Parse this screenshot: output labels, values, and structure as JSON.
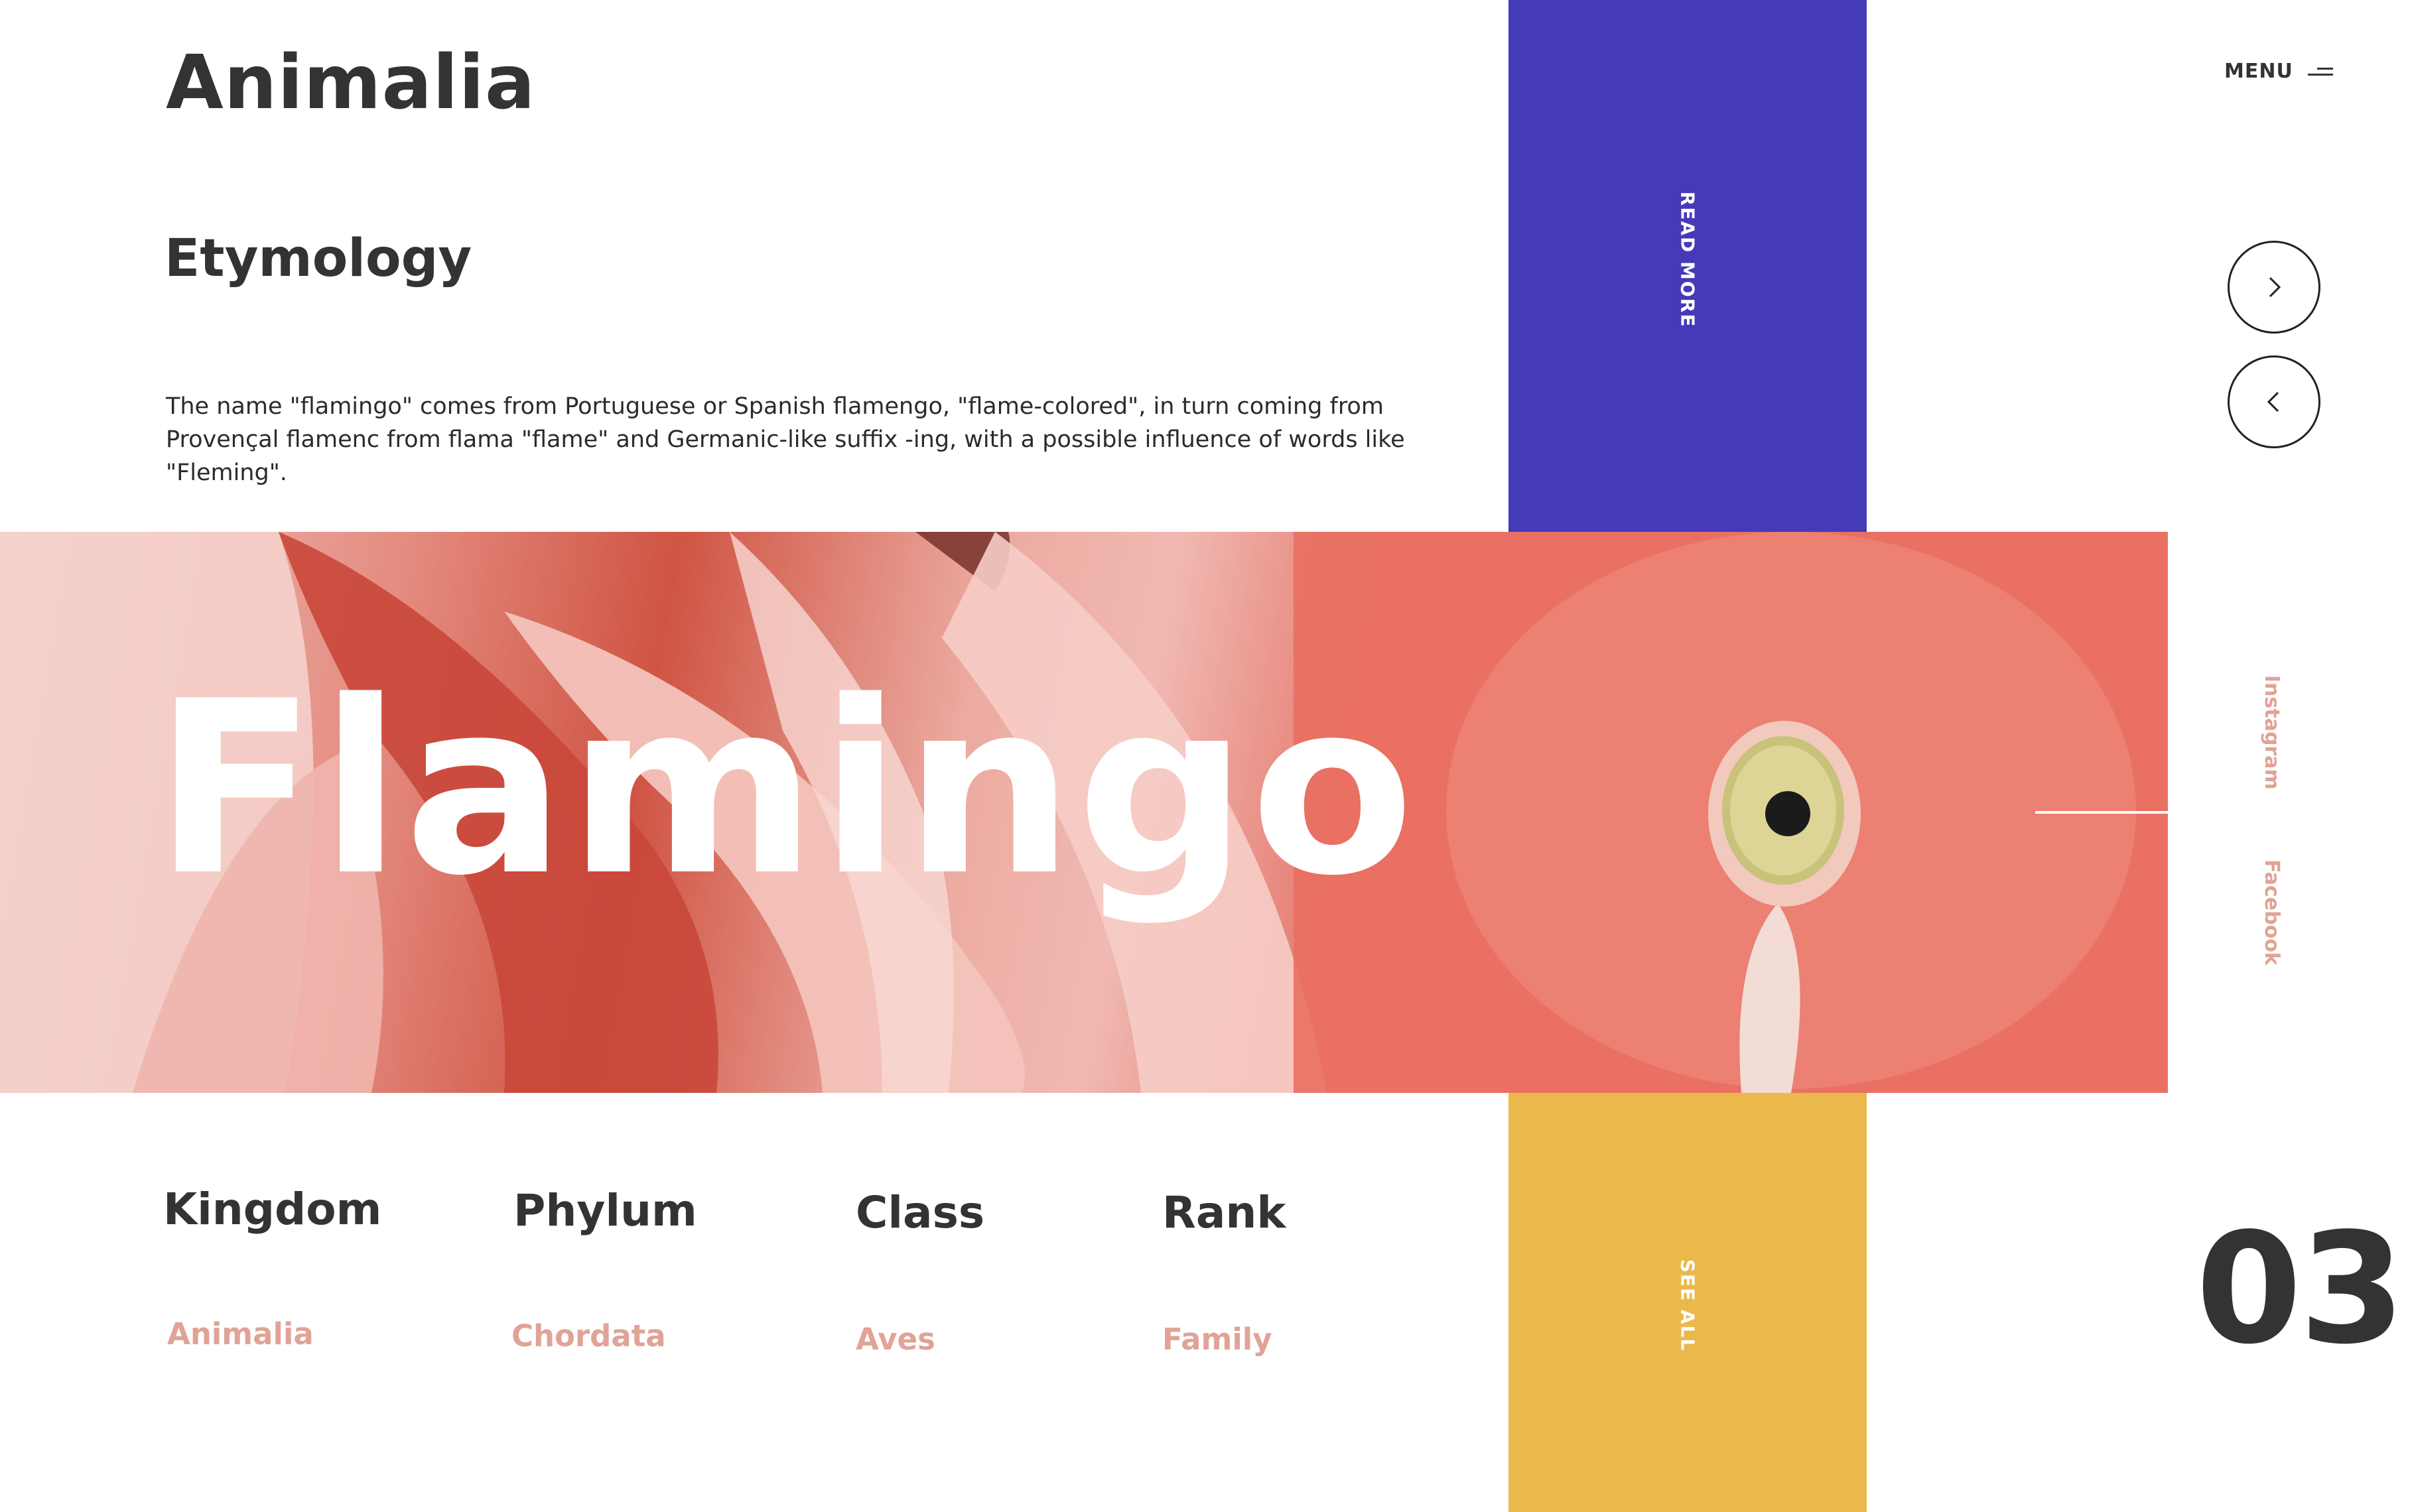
{
  "header": {
    "logo": "Animalia",
    "menu_label": "MENU",
    "menu_icon": "hamburger-icon"
  },
  "etymology": {
    "title": "Etymology",
    "body": "The name \"flamingo\" comes from Portuguese or Spanish flamengo, \"flame-colored\", in turn coming from Provençal flamenc from flama \"flame\" and Germanic-like suffix -ing, with a possible influence of words like \"Fleming\"."
  },
  "blocks": {
    "read_more": "READ MORE",
    "see_all": "SEE ALL"
  },
  "hero": {
    "title": "Flamingo"
  },
  "nav": {
    "next_icon": "chevron-right-icon",
    "prev_icon": "chevron-left-icon"
  },
  "social": {
    "instagram": "Instagram",
    "facebook": "Facebook"
  },
  "taxonomy": [
    {
      "heading": "Kingdom",
      "value": "Animalia"
    },
    {
      "heading": "Phylum",
      "value": "Chordata"
    },
    {
      "heading": "Class",
      "value": "Aves"
    },
    {
      "heading": "Rank",
      "value": "Family"
    }
  ],
  "slide_number": "03",
  "colors": {
    "primary_purple": "#453ab8",
    "accent_yellow": "#ebb84b",
    "accent_pink": "#e0a396",
    "text_dark": "#333333"
  }
}
